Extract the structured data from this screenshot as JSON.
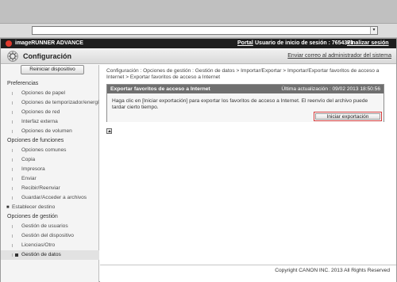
{
  "browser": {
    "address_value": "",
    "dropdown_glyph": "▾"
  },
  "topbar": {
    "product": "imageRUNNER ADVANCE",
    "portal": "Portal",
    "user_info": "Usuario de inicio de sesión : 7654321",
    "logout": "Finalizar sesión"
  },
  "header": {
    "title": "Configuración",
    "mail_admin": "Enviar correo al administrador del sistema"
  },
  "sidebar": {
    "restart_button": "Reiniciar dispositivo",
    "sections": [
      {
        "heading": "Preferencias",
        "items": [
          {
            "label": "Opciones de papel"
          },
          {
            "label": "Opciones de temporizador/energía"
          },
          {
            "label": "Opciones de red"
          },
          {
            "label": "Interfaz externa"
          },
          {
            "label": "Opciones de volumen"
          }
        ]
      },
      {
        "heading": "Opciones de funciones",
        "items": [
          {
            "label": "Opciones comunes"
          },
          {
            "label": "Copia"
          },
          {
            "label": "Impresora"
          },
          {
            "label": "Enviar"
          },
          {
            "label": "Recibir/Reenviar"
          },
          {
            "label": "Guardar/Acceder a archivos"
          }
        ]
      },
      {
        "heading": "Establecer destino",
        "expandable": true,
        "items": []
      },
      {
        "heading": "Opciones de gestión",
        "items": [
          {
            "label": "Gestión de usuarios"
          },
          {
            "label": "Gestión del dispositivo"
          },
          {
            "label": "Licencias/Otro"
          },
          {
            "label": "Gestión de datos",
            "active": true
          }
        ]
      }
    ]
  },
  "main": {
    "breadcrumb": "Configuración : Opciones de gestión : Gestión de datos > Importar/Exportar > Importar/Exportar favoritos de acceso a Internet > Exportar favoritos de acceso a Internet",
    "panel": {
      "title": "Exportar favoritos de acceso a Internet",
      "last_updated": "Última actualización : 09/02 2013 18:50:56",
      "instructions": "Haga clic en [Iniciar exportación] para exportar los favoritos de acceso a Internet. El reenvío del archivo puede tardar cierto tiempo.",
      "start_button": "Iniciar exportación"
    }
  },
  "footer": {
    "copyright": "Copyright CANON INC. 2013 All Rights Reserved"
  },
  "colors": {
    "topbar": "#1e1e1e",
    "logo_red": "#e03a2e",
    "panel_header": "#6f6f6f",
    "highlight_border": "#d23b3b"
  }
}
